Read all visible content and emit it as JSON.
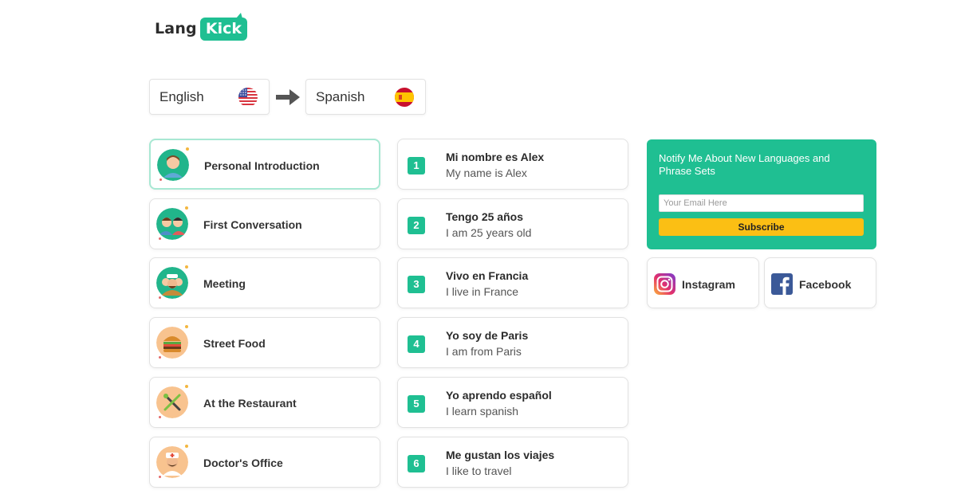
{
  "logo": {
    "part1": "Lang",
    "part2": "Kick"
  },
  "languages": {
    "from": {
      "label": "English",
      "flag": "us-flag-icon"
    },
    "to": {
      "label": "Spanish",
      "flag": "spain-flag-icon"
    }
  },
  "topics": [
    {
      "label": "Personal Introduction",
      "icon": "man-avatar-icon",
      "active": true
    },
    {
      "label": "First Conversation",
      "icon": "two-people-icon",
      "active": false
    },
    {
      "label": "Meeting",
      "icon": "group-meeting-icon",
      "active": false
    },
    {
      "label": "Street Food",
      "icon": "burger-icon",
      "active": false
    },
    {
      "label": "At the Restaurant",
      "icon": "fork-knife-icon",
      "active": false
    },
    {
      "label": "Doctor's Office",
      "icon": "doctor-icon",
      "active": false
    }
  ],
  "phrases": [
    {
      "num": "1",
      "es": "Mi nombre es Alex",
      "en": "My name is Alex"
    },
    {
      "num": "2",
      "es": "Tengo 25 años",
      "en": "I am 25 years old"
    },
    {
      "num": "3",
      "es": "Vivo en Francia",
      "en": "I live in France"
    },
    {
      "num": "4",
      "es": "Yo soy de Paris",
      "en": "I am from Paris"
    },
    {
      "num": "5",
      "es": "Yo aprendo español",
      "en": "I learn spanish"
    },
    {
      "num": "6",
      "es": "Me gustan los viajes",
      "en": "I like to travel"
    }
  ],
  "notify": {
    "heading": "Notify Me About New Languages and Phrase Sets",
    "placeholder": "Your Email Here",
    "button": "Subscribe"
  },
  "social": {
    "instagram": "Instagram",
    "facebook": "Facebook"
  },
  "colors": {
    "accent": "#1fbf92",
    "button": "#fbbf14"
  }
}
